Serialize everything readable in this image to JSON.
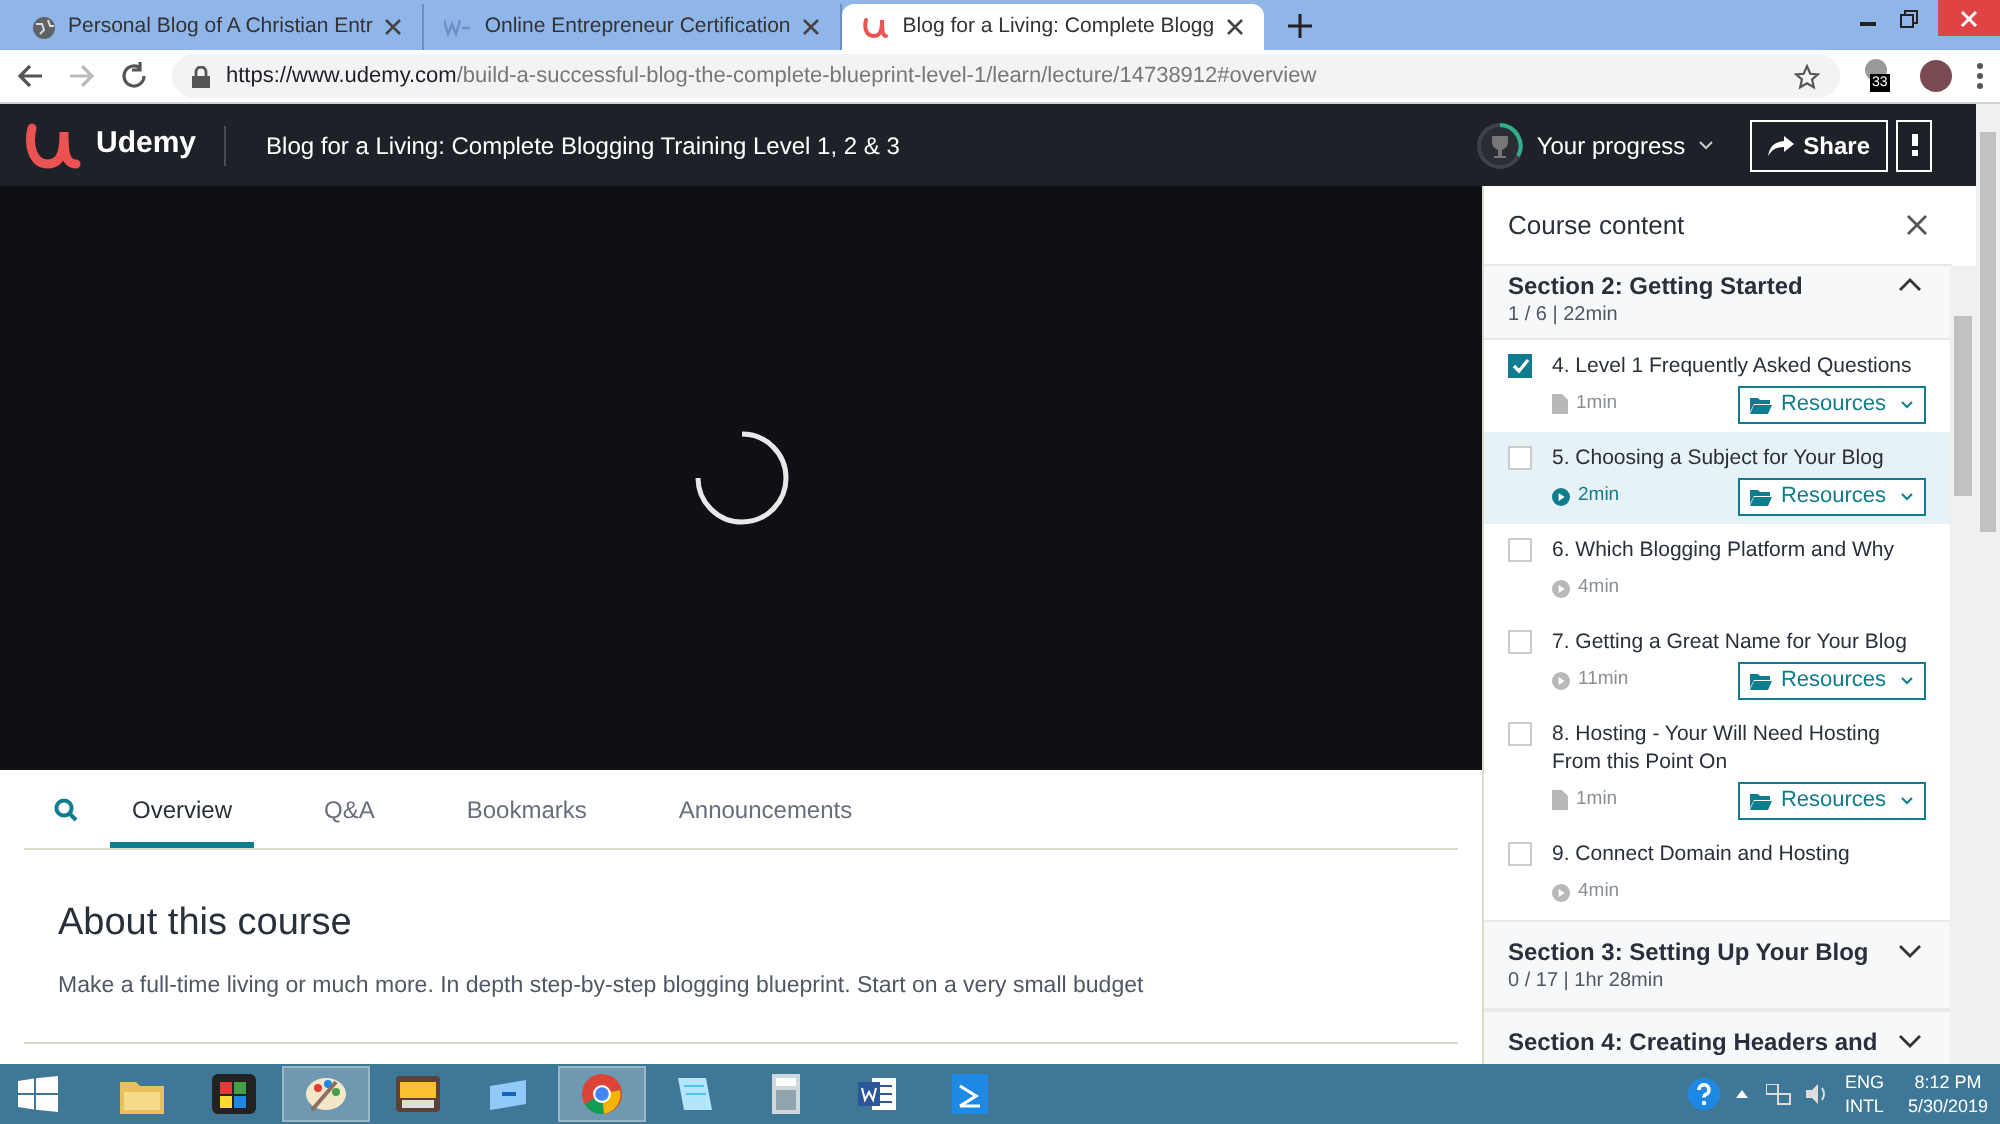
{
  "browser": {
    "tabs": [
      {
        "title": "Personal Blog of A Christian Entr",
        "kind": "globe",
        "selected": false
      },
      {
        "title": "Online Entrepreneur Certification",
        "kind": "wa",
        "selected": false
      },
      {
        "title": "Blog for a Living: Complete Blogg",
        "kind": "udemy",
        "selected": true
      }
    ],
    "url_host": "https://www.udemy.com",
    "url_path": "/build-a-successful-blog-the-complete-blueprint-level-1/learn/lecture/14738912#overview",
    "extension_badge": "33"
  },
  "header": {
    "logo": "Udemy",
    "course_title": "Blog for a Living: Complete Blogging Training Level 1, 2 & 3",
    "progress_label": "Your progress",
    "share_label": "Share"
  },
  "content_tabs": [
    {
      "label": "Overview",
      "selected": true
    },
    {
      "label": "Q&A",
      "selected": false
    },
    {
      "label": "Bookmarks",
      "selected": false
    },
    {
      "label": "Announcements",
      "selected": false
    }
  ],
  "about": {
    "title": "About this course",
    "description": "Make a full-time living or much more. In depth step-by-step blogging blueprint. Start on a very small budget"
  },
  "sidebar": {
    "title": "Course content",
    "sections": [
      {
        "title": "Section 2: Getting Started",
        "meta": "1 / 6 | 22min",
        "expanded": true,
        "lectures": [
          {
            "title": "4. Level 1 Frequently Asked Questions",
            "kind": "article",
            "duration": "1min",
            "completed": true,
            "selected": false,
            "resources": "Resources"
          },
          {
            "title": "5. Choosing a Subject for Your Blog",
            "kind": "video",
            "duration": "2min",
            "completed": false,
            "selected": true,
            "resources": "Resources"
          },
          {
            "title": "6. Which Blogging Platform and Why",
            "kind": "video",
            "duration": "4min",
            "completed": false,
            "selected": false
          },
          {
            "title": "7. Getting a Great Name for Your Blog",
            "kind": "video",
            "duration": "11min",
            "completed": false,
            "selected": false,
            "resources": "Resources"
          },
          {
            "title": "8. Hosting - Your Will Need Hosting From this Point On",
            "kind": "article",
            "duration": "1min",
            "completed": false,
            "selected": false,
            "resources": "Resources"
          },
          {
            "title": "9. Connect Domain and Hosting",
            "kind": "video",
            "duration": "4min",
            "completed": false,
            "selected": false
          }
        ]
      },
      {
        "title": "Section 3: Setting Up Your Blog",
        "meta": "0 / 17 | 1hr 28min",
        "expanded": false
      },
      {
        "title": "Section 4: Creating Headers and",
        "expanded": false
      }
    ]
  },
  "taskbar": {
    "apps": [
      {
        "kind": "folder",
        "active": false
      },
      {
        "kind": "tiles",
        "active": false
      },
      {
        "kind": "palette",
        "active": true
      },
      {
        "kind": "drive",
        "active": false
      },
      {
        "kind": "window",
        "active": false
      },
      {
        "kind": "chrome",
        "active": true
      },
      {
        "kind": "notepad",
        "active": false
      },
      {
        "kind": "calculator",
        "active": false
      },
      {
        "kind": "word",
        "active": false
      },
      {
        "kind": "scan",
        "active": false
      }
    ],
    "language": "ENG",
    "layout": "INTL",
    "time": "8:12 PM",
    "date": "5/30/2019"
  }
}
